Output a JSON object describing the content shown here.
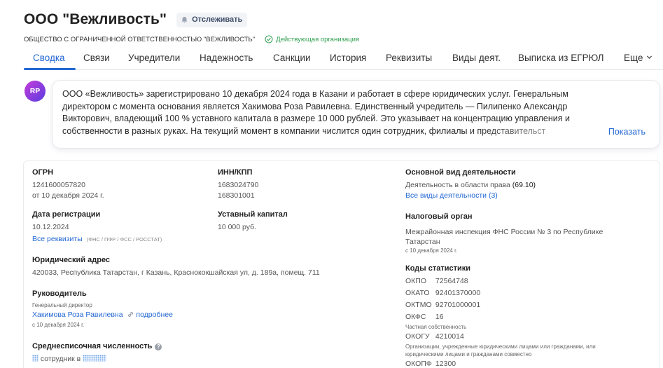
{
  "company": {
    "name": "ООО \"Вежливость\"",
    "track_label": "Отслеживать",
    "full_name": "ОБЩЕСТВО С ОГРАНИЧЕННОЙ ОТВЕТСТВЕННОСТЬЮ \"ВЕЖЛИВОСТЬ\"",
    "status": "Действующая организация"
  },
  "tabs": [
    {
      "label": "Сводка",
      "active": true
    },
    {
      "label": "Связи"
    },
    {
      "label": "Учредители"
    },
    {
      "label": "Надежность"
    },
    {
      "label": "Санкции"
    },
    {
      "label": "История"
    },
    {
      "label": "Реквизиты"
    },
    {
      "label": "Виды деят."
    },
    {
      "label": "Выписка из ЕГРЮЛ"
    },
    {
      "label": "Еще"
    }
  ],
  "summary": {
    "avatar_initials": "RP",
    "text": "ООО «Вежливость» зарегистрировано 10 декабря 2024 года в Казани и работает в сфере юридических услуг. Генеральным директором с момента основания является Хакимова Роза Равилевна. Единственный учредитель — Пилипенко Александр Викторович, владеющий 100 % уставного капитала в размере 10 000 рублей. Это указывает на концентрацию управления и собственности в разных руках. На текущий момент в компании числится один сотрудник, филиалы и представительст",
    "show_label": "Показать"
  },
  "details": {
    "ogrn": {
      "label": "ОГРН",
      "value": "1241600057820",
      "date": "от 10 декабря 2024 г."
    },
    "reg": {
      "label": "Дата регистрации",
      "value": "10.12.2024",
      "link": "Все реквизиты",
      "tag": "(ФНС / ПФР / ФСС / РОССТАТ)"
    },
    "address": {
      "label": "Юридический адрес",
      "value": "420033, Республика Татарстан, г Казань, Краснококшайская ул, д. 189а, помещ. 711"
    },
    "head": {
      "label": "Руководитель",
      "position": "Генеральный директор",
      "name": "Хакимова Роза Равилевна",
      "more": "подробнее",
      "since": "с 10 декабря 2024 г."
    },
    "employees": {
      "label": "Среднесписочная численность",
      "info": "?",
      "value": "сотрудник в"
    },
    "inn": {
      "label": "ИНН/КПП",
      "inn": "1683024790",
      "kpp": "168301001"
    },
    "capital": {
      "label": "Уставный капитал",
      "value": "10 000 руб."
    },
    "activity": {
      "label": "Основной вид деятельности",
      "value": "Деятельность в области права",
      "code": "(69.10)",
      "link": "Все виды деятельности (3)"
    },
    "tax": {
      "label": "Налоговый орган",
      "line1": "Межрайонная инспекция ФНС России № 3 по Республике",
      "line2": "Татарстан",
      "since": "с 10 декабря 2024 г."
    },
    "codes": {
      "label": "Коды статистики",
      "okpo": {
        "k": "ОКПО",
        "v": "72564748"
      },
      "okato": {
        "k": "ОКАТО",
        "v": "92401370000"
      },
      "oktmo": {
        "k": "ОКТМО",
        "v": "92701000001"
      },
      "okfs": {
        "k": "ОКФС",
        "v": "16",
        "desc": "Частная собственность"
      },
      "okogu": {
        "k": "ОКОГУ",
        "v": "4210014",
        "desc1": "Организации, учрежденные юридическими лицами или гражданами, или",
        "desc2": "юридическими лицами и гражданами совместно"
      },
      "okopf": {
        "k": "ОКОПФ",
        "v": "12300"
      }
    }
  },
  "colors": {
    "accent": "#2368d4",
    "status_green": "#2e9e4e"
  },
  "icons": [
    "bell-icon",
    "check-circle-icon",
    "chevron-down-icon",
    "link-icon",
    "info-icon"
  ]
}
